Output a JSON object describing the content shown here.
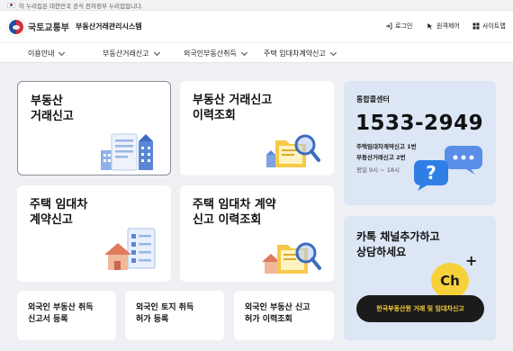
{
  "govbar": {
    "text": "이 누리집은 대한민국 공식 전자정부 누리집입니다."
  },
  "header": {
    "ministry": "국토교통부",
    "system_name": "부동산거래관리시스템",
    "utils": [
      {
        "label": "로그인",
        "icon": "login-icon"
      },
      {
        "label": "원격제어",
        "icon": "cursor-icon"
      },
      {
        "label": "사이트맵",
        "icon": "grid-icon"
      }
    ]
  },
  "nav": [
    {
      "label": "이용안내"
    },
    {
      "label": "부동산거래신고"
    },
    {
      "label": "외국인부동산취득"
    },
    {
      "label": "주택 임대차계약신고"
    }
  ],
  "cards": [
    {
      "title": "부동산\n거래신고",
      "illustration": "buildings-document-illustration"
    },
    {
      "title": "부동산 거래신고\n이력조회",
      "illustration": "folder-magnifier-illustration"
    },
    {
      "title": "주택 임대차\n계약신고",
      "illustration": "house-checklist-illustration"
    },
    {
      "title": "주택 임대차 계약\n신고 이력조회",
      "illustration": "house-folder-magnifier-illustration"
    }
  ],
  "small_cards": [
    {
      "title": "외국인 부동산 취득\n신고서 등록"
    },
    {
      "title": "외국인 토지 취득\n허가 등록"
    },
    {
      "title": "외국인 부동산 신고\n허가 이력조회"
    }
  ],
  "callcenter": {
    "label": "통합콜센터",
    "phone": "1533-2949",
    "line1": "주택임대차계약신고 1번",
    "line2": "부동산거래신고 2번",
    "hours": "평일 9시 ~ 18시",
    "colors": {
      "bubble_blue": "#2f7ee6"
    }
  },
  "kakao": {
    "title": "카톡 채널추가하고\n상담하세요",
    "channel_mark": "Ch",
    "button_label": "한국부동산원 거래 및 임대차신고",
    "colors": {
      "yellow": "#f7d13a",
      "dark": "#1b1b1b"
    }
  }
}
